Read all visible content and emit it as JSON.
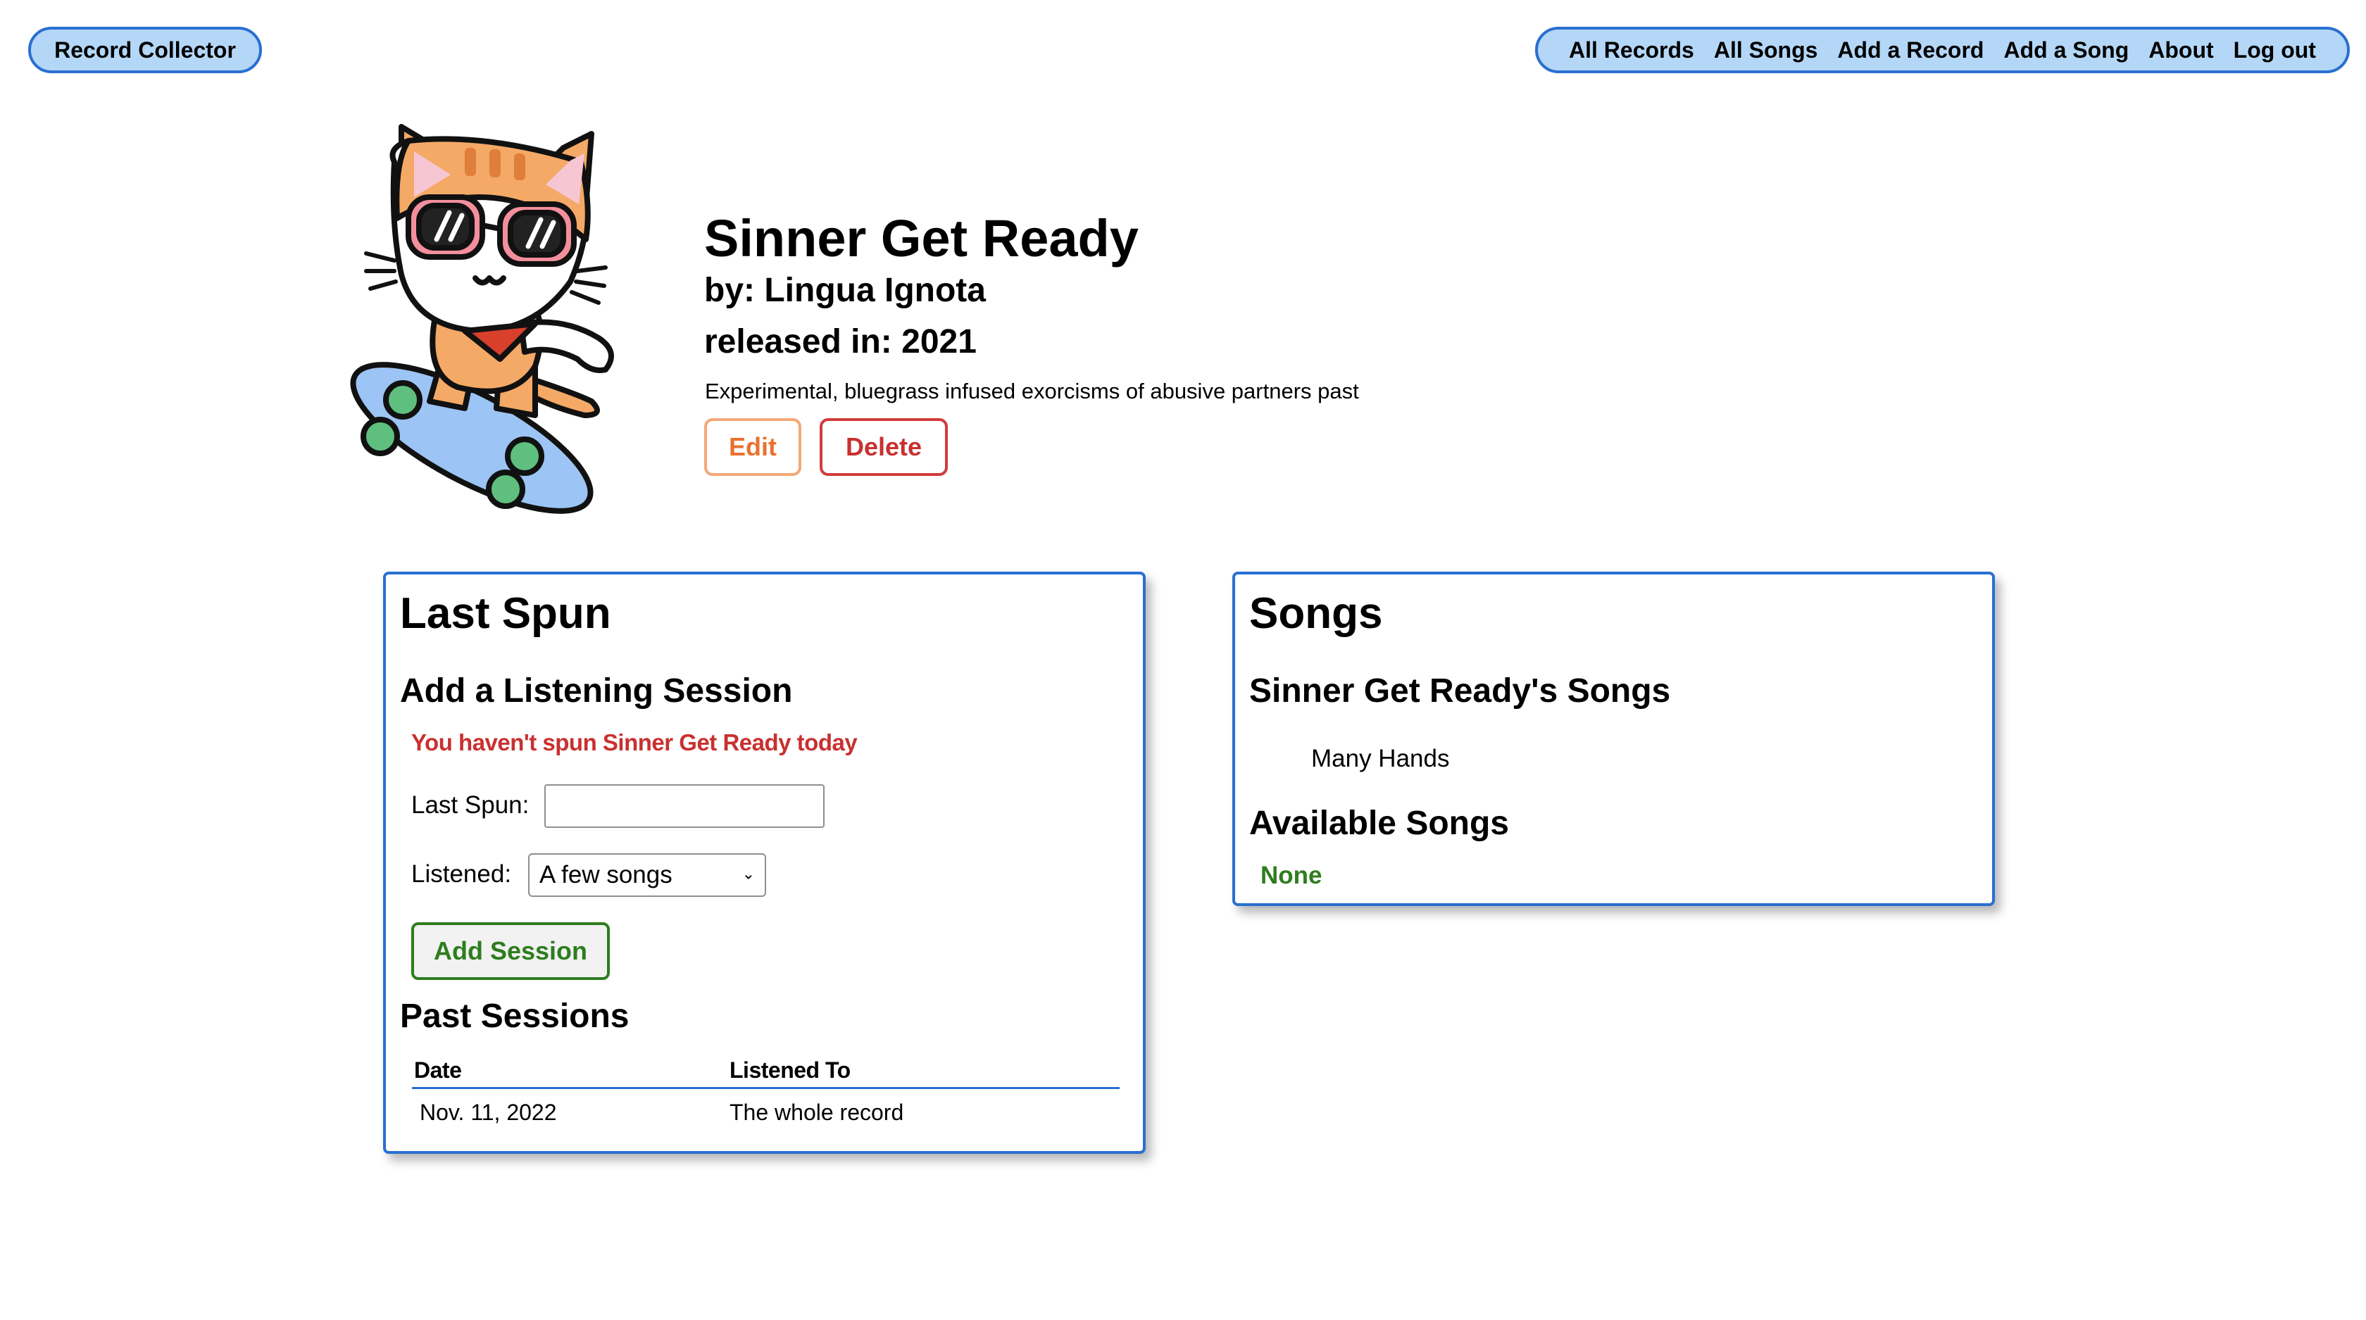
{
  "nav": {
    "brand": "Record Collector",
    "links": [
      "All Records",
      "All Songs",
      "Add a Record",
      "Add a Song",
      "About",
      "Log out"
    ]
  },
  "record": {
    "title": "Sinner Get Ready",
    "artist_line": "by: Lingua Ignota",
    "released_line": "released in: 2021",
    "description": "Experimental, bluegrass infused exorcisms of abusive partners past",
    "edit_label": "Edit",
    "delete_label": "Delete"
  },
  "last_spun": {
    "heading": "Last Spun",
    "subheading": "Add a Listening Session",
    "warning": "You haven't spun Sinner Get Ready today",
    "last_spun_label": "Last Spun:",
    "last_spun_value": "",
    "listened_label": "Listened:",
    "listened_selected": "A few songs",
    "submit_label": "Add Session",
    "past_heading": "Past Sessions",
    "table": {
      "headers": [
        "Date",
        "Listened To"
      ],
      "rows": [
        [
          "Nov. 11, 2022",
          "The whole record"
        ]
      ]
    }
  },
  "songs": {
    "heading": "Songs",
    "record_songs_heading": "Sinner Get Ready's Songs",
    "record_songs": [
      "Many Hands"
    ],
    "available_heading": "Available Songs",
    "available_empty": "None"
  },
  "colors": {
    "accent_blue": "#2a6fd1",
    "nav_fill": "#b4d7f7",
    "edit_orange": "#e8712f",
    "delete_red": "#c93030",
    "success_green": "#2e7d1e"
  },
  "icons": {
    "mascot": "skateboarding-cat-with-sunglasses"
  }
}
